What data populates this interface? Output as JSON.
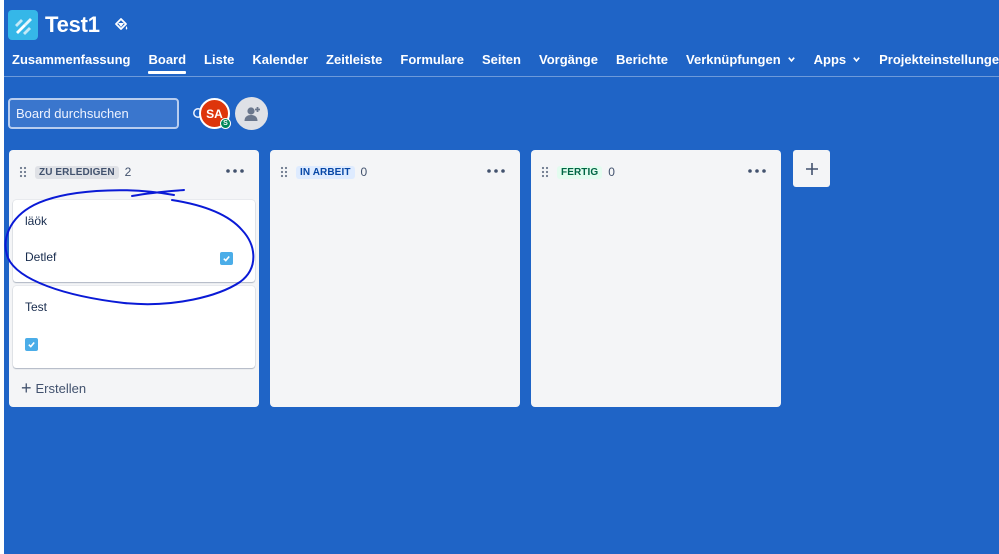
{
  "project": {
    "title": "Test1",
    "logo_icon": "project-rocket-icon",
    "theme_icon": "paint-bucket-icon"
  },
  "nav": {
    "tabs": [
      {
        "label": "Zusammenfassung",
        "active": false
      },
      {
        "label": "Board",
        "active": true
      },
      {
        "label": "Liste",
        "active": false
      },
      {
        "label": "Kalender",
        "active": false
      },
      {
        "label": "Zeitleiste",
        "active": false
      },
      {
        "label": "Formulare",
        "active": false
      },
      {
        "label": "Seiten",
        "active": false
      },
      {
        "label": "Vorgänge",
        "active": false
      },
      {
        "label": "Berichte",
        "active": false
      },
      {
        "label": "Verknüpfungen",
        "active": false,
        "dropdown": true
      },
      {
        "label": "Apps",
        "active": false,
        "dropdown": true
      },
      {
        "label": "Projekteinstellungen",
        "active": false
      }
    ]
  },
  "search": {
    "placeholder": "Board durchsuchen",
    "icon": "search-icon"
  },
  "avatar": {
    "initials": "SA",
    "badge": "S",
    "color": "#de350b",
    "badge_color": "#00875a"
  },
  "columns": [
    {
      "title": "ZU ERLEDIGEN",
      "count": "2",
      "cards": [
        {
          "title": "läök",
          "assignee": "Detlef",
          "checked": true
        },
        {
          "title": "Test",
          "assignee": "",
          "checked": true
        }
      ],
      "create_label": "Erstellen"
    },
    {
      "title": "IN ARBEIT",
      "count": "0",
      "cards": []
    },
    {
      "title": "FERTIG",
      "count": "0",
      "cards": []
    }
  ],
  "add_column_label": "+",
  "colors": {
    "background": "#1f64c6",
    "column": "#f4f5f7",
    "checkbox": "#4bade8",
    "annotation": "#0a1ad6"
  }
}
